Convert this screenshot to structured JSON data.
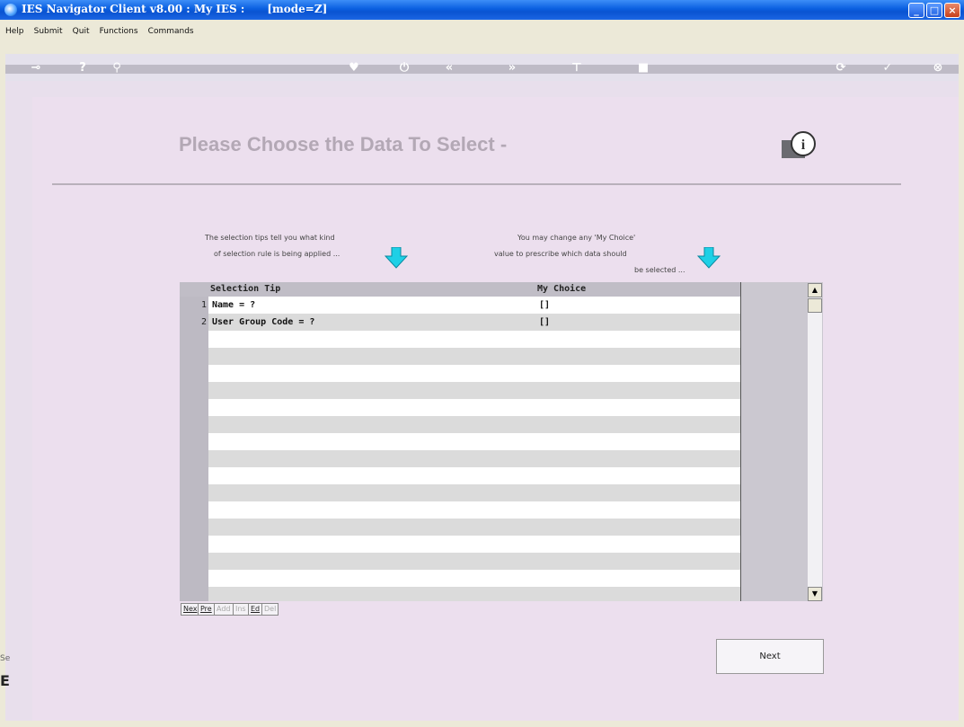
{
  "window": {
    "title": "IES Navigator Client v8.00 : My IES :      [mode=Z]"
  },
  "menu": [
    "Help",
    "Submit",
    "Quit",
    "Functions",
    "Commands"
  ],
  "toolbar": {
    "icons": [
      "key-icon",
      "help-icon",
      "search-icon",
      "heart-icon",
      "power-icon",
      "rewind-icon",
      "forward-icon",
      "tree-icon",
      "stop-icon",
      "refresh-icon",
      "check-icon",
      "close-icon"
    ]
  },
  "heading": "Please Choose the Data To Select -",
  "tips": {
    "left_line1": "The selection tips tell you what kind",
    "left_line2": "of selection rule is being applied ...",
    "right_line1": "You may change any 'My Choice'",
    "right_line2": "value to prescribe which data should",
    "right_line3": "be selected ..."
  },
  "grid": {
    "col_tip": "Selection Tip",
    "col_choice": "My Choice",
    "rows": [
      {
        "num": "1",
        "tip": "Name = ?",
        "choice": "[]"
      },
      {
        "num": "2",
        "tip": "User Group Code = ?",
        "choice": "[]"
      }
    ]
  },
  "nav": {
    "nex": "Nex",
    "pre": "Pre",
    "add": "Add",
    "ins": "Ins",
    "ed": "Ed",
    "del": "Del"
  },
  "next_label": "Next",
  "side": {
    "label": "Se",
    "glyph": "E"
  },
  "colors": {
    "panel": "#ecdfee",
    "arrow": "#1ed0e6",
    "titlebar": "#0a5fe0"
  }
}
